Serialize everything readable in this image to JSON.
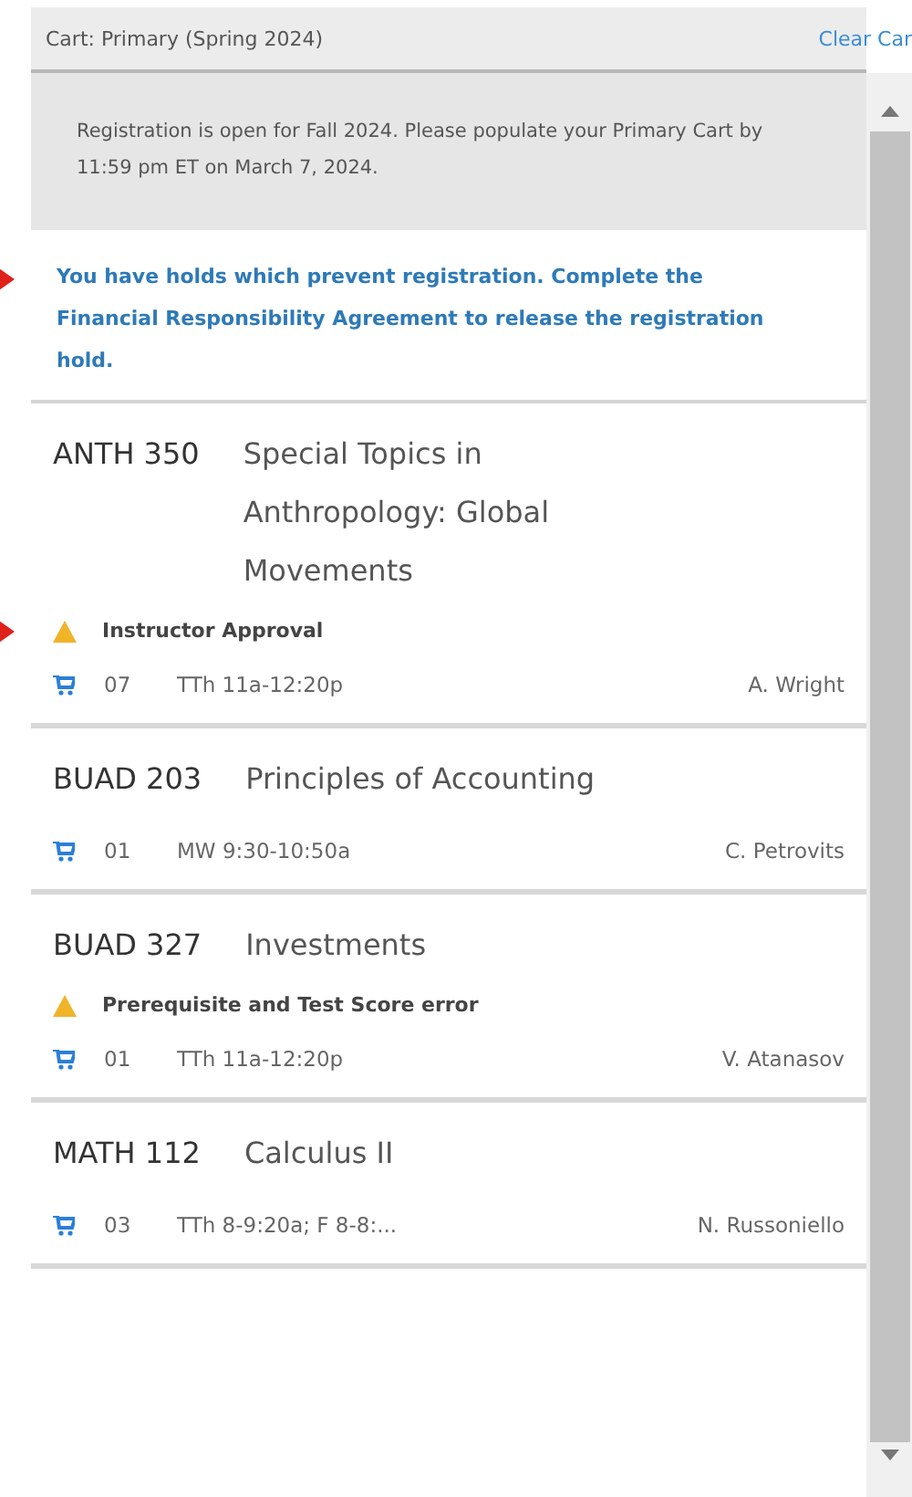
{
  "header": {
    "title": "Cart: Primary (Spring 2024)",
    "action": "Clear Car"
  },
  "notice": "Registration is open for Fall 2024. Please populate your Primary Cart by 11:59 pm ET on March 7, 2024.",
  "hold": {
    "text": "You have holds which prevent registration. Complete the Financial Responsibility Agreement to release the registration hold.",
    "marked": true
  },
  "courses": [
    {
      "code": "ANTH 350",
      "title": "Special Topics in Anthropology: Global Movements",
      "warning": "Instructor Approval",
      "marked": true,
      "section": "07",
      "time": "TTh 11a-12:20p",
      "instructor": "A. Wright"
    },
    {
      "code": "BUAD 203",
      "title": "Principles of Accounting",
      "section": "01",
      "time": "MW 9:30-10:50a",
      "instructor": "C. Petrovits"
    },
    {
      "code": "BUAD 327",
      "title": "Investments",
      "warning": "Prerequisite and Test Score error",
      "marked": false,
      "section": "01",
      "time": "TTh 11a-12:20p",
      "instructor": "V. Atanasov"
    },
    {
      "code": "MATH 112",
      "title": "Calculus II",
      "section": "03",
      "time": "TTh 8-9:20a; F 8-8:...",
      "instructor": "N. Russoniello"
    }
  ]
}
